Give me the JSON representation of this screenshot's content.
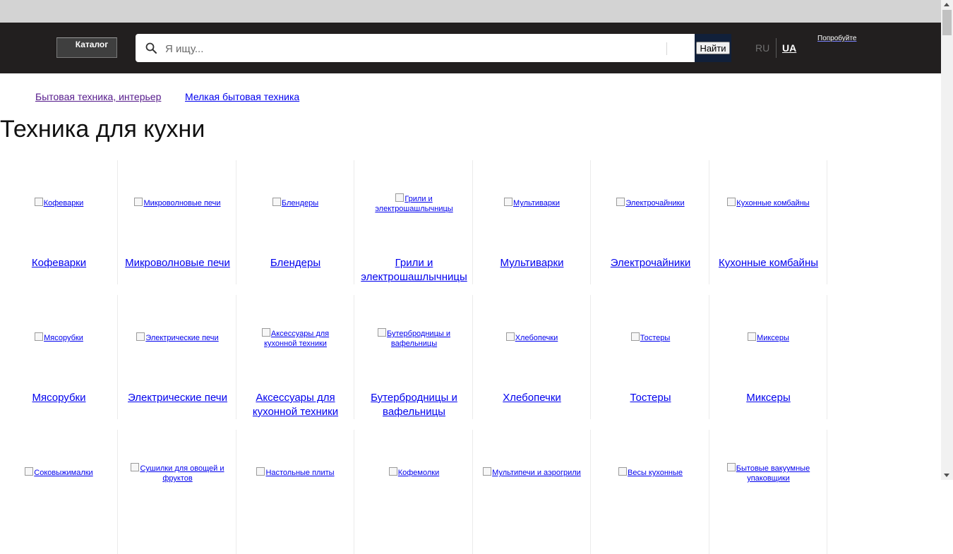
{
  "header": {
    "catalog_label": "Каталог",
    "search_placeholder": "Я ищу...",
    "search_button": "Найти",
    "lang_ru": "RU",
    "lang_ua": "UA",
    "promo": "Попробуйте"
  },
  "breadcrumbs": [
    "Бытовая техника, интерьер",
    "Мелкая бытовая техника"
  ],
  "page_title": "Техника для кухни",
  "categories": [
    {
      "label": "Кофеварки",
      "alt": "Кофеварки"
    },
    {
      "label": "Микроволновые печи",
      "alt": "Микроволновые печи"
    },
    {
      "label": "Блендеры",
      "alt": "Блендеры"
    },
    {
      "label": "Грили и электрошашлычницы",
      "alt": "Грили и электрошашлычницы"
    },
    {
      "label": "Мультиварки",
      "alt": "Мультиварки"
    },
    {
      "label": "Электрочайники",
      "alt": "Электрочайники"
    },
    {
      "label": "Кухонные комбайны",
      "alt": "Кухонные комбайны"
    },
    {
      "label": "Мясорубки",
      "alt": "Мясорубки"
    },
    {
      "label": "Электрические печи",
      "alt": "Электрические печи"
    },
    {
      "label": "Аксессуары для кухонной техники",
      "alt": "Аксессуары для кухонной техники"
    },
    {
      "label": "Бутербродницы и вафельницы",
      "alt": "Бутербродницы и вафельницы"
    },
    {
      "label": "Хлебопечки",
      "alt": "Хлебопечки"
    },
    {
      "label": "Тостеры",
      "alt": "Тостеры"
    },
    {
      "label": "Миксеры",
      "alt": "Миксеры"
    },
    {
      "label": "",
      "alt": "Соковыжималки"
    },
    {
      "label": "",
      "alt": "Сушилки для овощей и фруктов"
    },
    {
      "label": "",
      "alt": "Настольные плиты"
    },
    {
      "label": "",
      "alt": "Кофемолки"
    },
    {
      "label": "",
      "alt": "Мультипечи и аэрогрили"
    },
    {
      "label": "",
      "alt": "Весы кухонные"
    },
    {
      "label": "",
      "alt": "Бытовые вакуумные упаковщики"
    }
  ]
}
